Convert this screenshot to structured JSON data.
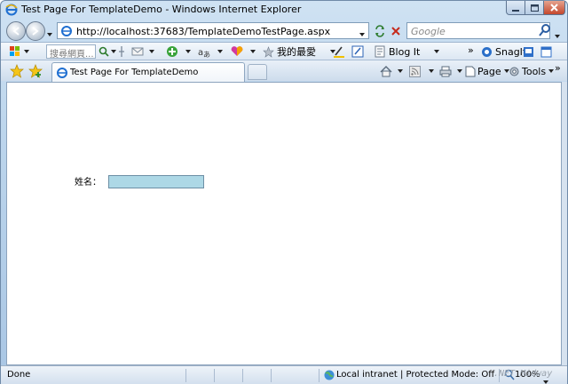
{
  "window": {
    "title": "Test Page For TemplateDemo - Windows Internet Explorer"
  },
  "address_bar": {
    "url": "http://localhost:37683/TemplateDemoTestPage.aspx",
    "search_placeholder": "Google"
  },
  "command_bar": {
    "search_input_placeholder": "搜尋網頁...",
    "favorites_label": "我的最愛",
    "blog_label": "Blog It",
    "snagit_label": "SnagIt",
    "page_label": "Page",
    "tools_label": "Tools",
    "chevron": "»"
  },
  "tabs": [
    {
      "label": "Test Page For TemplateDemo"
    }
  ],
  "content": {
    "name_label": "姓名：",
    "name_value": ""
  },
  "status_bar": {
    "status": "Done",
    "zone": "Local intranet | Protected Mode: Off",
    "zoom": "100%"
  },
  "watermark": ".NET Midway",
  "colors": {
    "name_input_bg": "#add8e6"
  }
}
